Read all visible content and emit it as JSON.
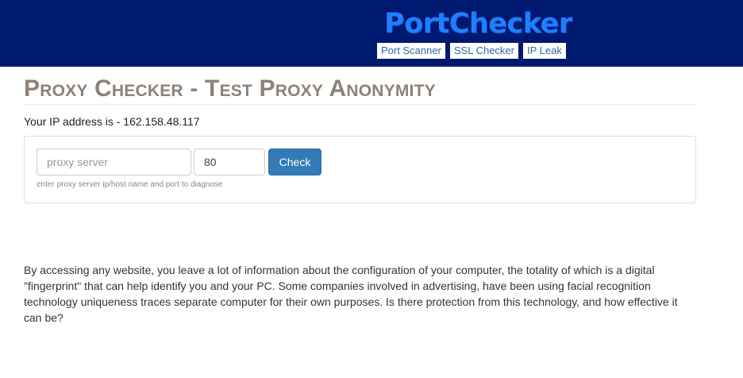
{
  "header": {
    "logo_text": "PortChecker",
    "nav": [
      {
        "label": "Port Scanner"
      },
      {
        "label": "SSL Checker"
      },
      {
        "label": "IP Leak"
      }
    ]
  },
  "page": {
    "title": "Proxy Checker - Test Proxy Anonymity",
    "ip_line": "Your IP address is - 162.158.48.117"
  },
  "form": {
    "proxy_placeholder": "proxy server",
    "proxy_value": "",
    "port_value": "80",
    "check_label": "Check",
    "hint": "enter proxy server ip/host name and port to diagnose"
  },
  "content": {
    "paragraph": "By accessing any website, you leave a lot of information about the configuration of your computer, the totality of which is a digital \"fingerprint\" that can help identify you and your PC. Some companies involved in advertising, have been using facial recognition technology uniqueness traces separate computer for their own purposes. Is there protection from this technology, and how effective it can be?"
  },
  "colors": {
    "header_bg": "#001970",
    "logo": "#1e7fff",
    "title": "#8c8278",
    "button": "#337ab7"
  }
}
